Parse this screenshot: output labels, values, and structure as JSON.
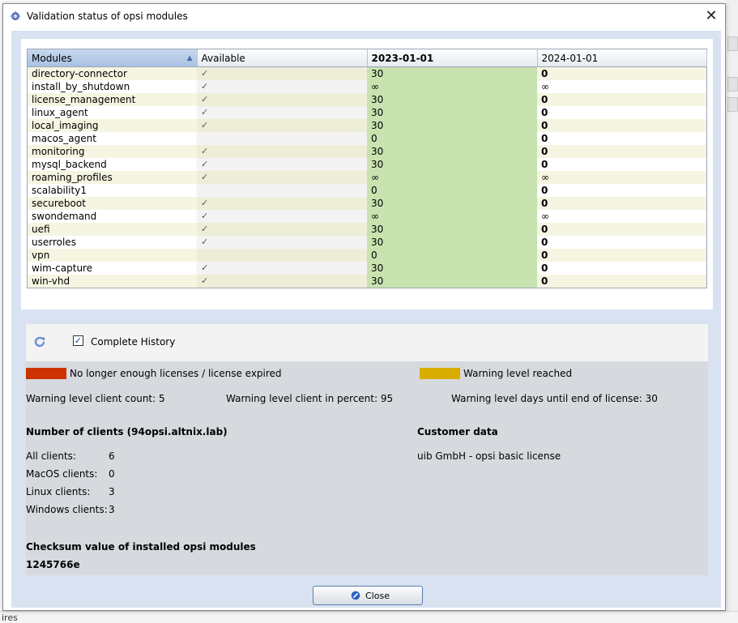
{
  "window": {
    "title": "Validation status of opsi modules",
    "close_glyph": "✕"
  },
  "table": {
    "columns": [
      "Modules",
      "Available",
      "2023-01-01",
      "2024-01-01"
    ],
    "rows": [
      {
        "module": "directory-connector",
        "available": true,
        "v2023": "30",
        "v2024": "0"
      },
      {
        "module": "install_by_shutdown",
        "available": true,
        "v2023": "∞",
        "v2024": "∞"
      },
      {
        "module": "license_management",
        "available": true,
        "v2023": "30",
        "v2024": "0"
      },
      {
        "module": "linux_agent",
        "available": true,
        "v2023": "30",
        "v2024": "0"
      },
      {
        "module": "local_imaging",
        "available": true,
        "v2023": "30",
        "v2024": "0"
      },
      {
        "module": "macos_agent",
        "available": false,
        "v2023": "0",
        "v2024": "0"
      },
      {
        "module": "monitoring",
        "available": true,
        "v2023": "30",
        "v2024": "0"
      },
      {
        "module": "mysql_backend",
        "available": true,
        "v2023": "30",
        "v2024": "0"
      },
      {
        "module": "roaming_profiles",
        "available": true,
        "v2023": "∞",
        "v2024": "∞"
      },
      {
        "module": "scalability1",
        "available": false,
        "v2023": "0",
        "v2024": "0"
      },
      {
        "module": "secureboot",
        "available": true,
        "v2023": "30",
        "v2024": "0"
      },
      {
        "module": "swondemand",
        "available": true,
        "v2023": "∞",
        "v2024": "∞"
      },
      {
        "module": "uefi",
        "available": true,
        "v2023": "30",
        "v2024": "0"
      },
      {
        "module": "userroles",
        "available": true,
        "v2023": "30",
        "v2024": "0"
      },
      {
        "module": "vpn",
        "available": false,
        "v2023": "0",
        "v2024": "0"
      },
      {
        "module": "wim-capture",
        "available": true,
        "v2023": "30",
        "v2024": "0"
      },
      {
        "module": "win-vhd",
        "available": true,
        "v2023": "30",
        "v2024": "0"
      }
    ],
    "check_glyph": "✓",
    "sort_glyph": "▲"
  },
  "toolbar": {
    "complete_history_label": "Complete History",
    "complete_history_checked": true,
    "check_glyph": "✓"
  },
  "legend": {
    "expired_label": "No longer enough licenses / license expired",
    "expired_color": "#cc3300",
    "warning_label": "Warning level reached",
    "warning_color": "#d9ad00"
  },
  "warning_levels": {
    "client_count": "Warning level client count: 5",
    "client_percent": "Warning level client in percent: 95",
    "days_until_end": "Warning level days until end of license: 30"
  },
  "clients": {
    "heading": "Number of clients (94opsi.altnix.lab)",
    "rows": [
      {
        "label": "All clients:",
        "value": "6"
      },
      {
        "label": "MacOS clients:",
        "value": "0"
      },
      {
        "label": "Linux clients:",
        "value": "3"
      },
      {
        "label": "Windows clients:",
        "value": "3"
      }
    ]
  },
  "customer": {
    "heading": "Customer data",
    "value": "uib GmbH - opsi basic license"
  },
  "checksum": {
    "heading": "Checksum value of installed opsi modules",
    "value": "1245766e"
  },
  "close_button": {
    "label": "Close"
  },
  "background": {
    "bottom_fragment": "ires"
  },
  "colors": {
    "valid_cell": "#c8e2b0",
    "accent": "#4a6ea9",
    "info_bg": "#d6d9de"
  }
}
